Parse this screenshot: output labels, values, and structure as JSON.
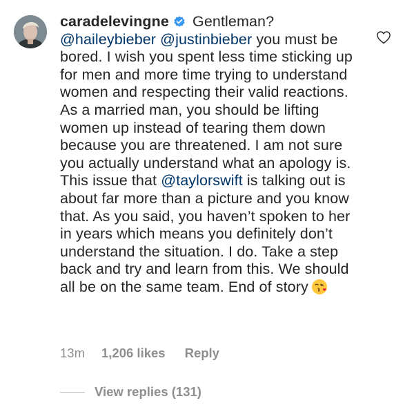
{
  "comment": {
    "username": "caradelevingne",
    "verified_icon": "verified-badge-icon",
    "segments": [
      {
        "type": "text",
        "value": " Gentleman? "
      },
      {
        "type": "mention",
        "value": "@haileybieber"
      },
      {
        "type": "text",
        "value": " "
      },
      {
        "type": "mention",
        "value": "@justinbieber"
      },
      {
        "type": "text",
        "value": " you must be bored. I wish you spent less time sticking up for men and more time trying to understand women and respecting their valid reactions. As a married man, you should be lifting women up instead of tearing them down because you are threatened. I am not sure you actually understand what an apology is. This issue that "
      },
      {
        "type": "mention",
        "value": "@taylorswift"
      },
      {
        "type": "text",
        "value": " is talking out is about far more than a picture and you know that. As you said, you haven’t spoken to her in years which means you definitely don’t understand the situation. I do. Take a step back and try and learn from this. We should all be on the same team. End of story"
      }
    ],
    "emoji_icon": "face-blowing-kiss-emoji-icon",
    "like_icon": "heart-outline-icon"
  },
  "meta": {
    "time": "13m",
    "likes": "1,206 likes",
    "reply_label": "Reply"
  },
  "replies": {
    "label": "View replies (131)"
  },
  "colors": {
    "text": "#262626",
    "mention": "#003569",
    "secondary": "#8e8e8e",
    "verified": "#3897f0"
  }
}
